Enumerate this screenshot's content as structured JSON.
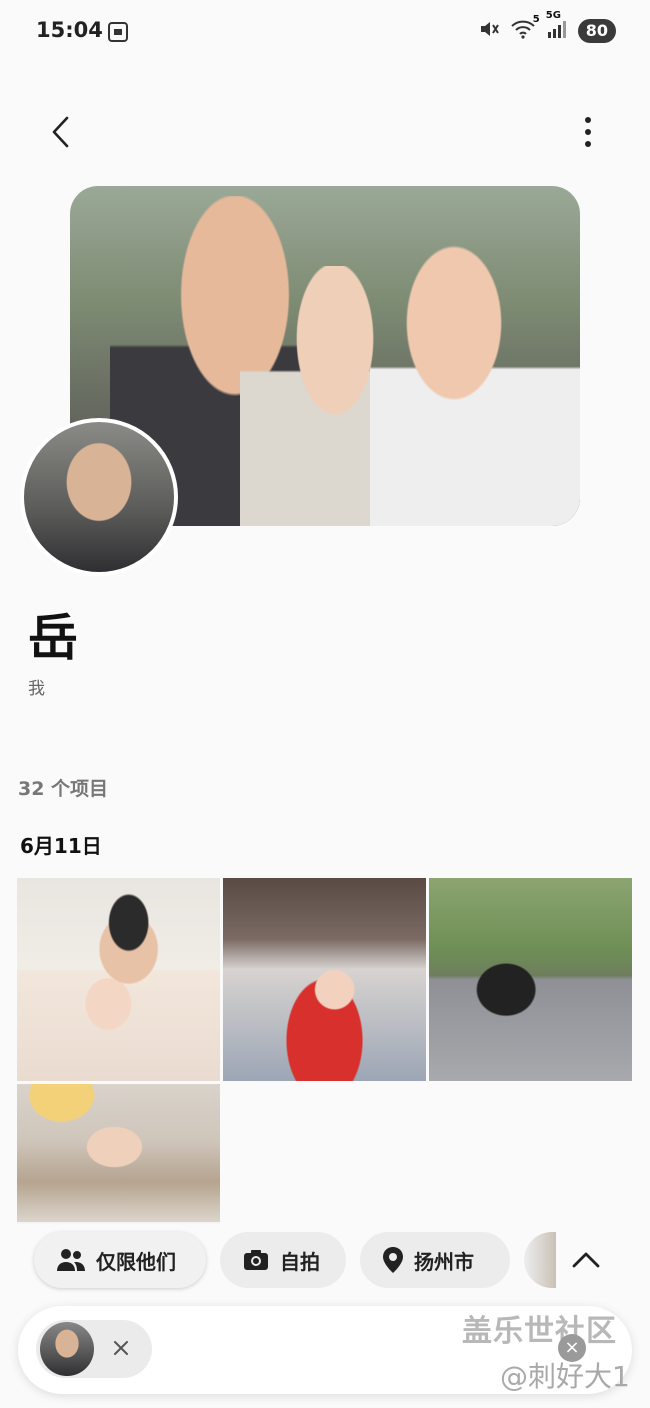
{
  "status_bar": {
    "time": "15:04",
    "network": "5G",
    "wifi_badge": "5",
    "battery": "80"
  },
  "header": {
    "back_icon": "back-arrow-icon",
    "more_icon": "more-vertical-icon"
  },
  "profile": {
    "name": "岳",
    "relation": "我"
  },
  "album": {
    "item_count": "32 个项目",
    "date_header": "6月11日"
  },
  "filters": [
    {
      "label": "仅限他们",
      "icon": "people-icon"
    },
    {
      "label": "自拍",
      "icon": "camera-icon"
    },
    {
      "label": "扬州市",
      "icon": "location-pin-icon"
    }
  ],
  "watermark": {
    "line1": "盖乐世社区",
    "line2": "@刺好大1"
  },
  "colors": {
    "background": "#fafafa",
    "chip_bg": "#ececec",
    "text_primary": "#111111",
    "text_secondary": "#777777"
  }
}
